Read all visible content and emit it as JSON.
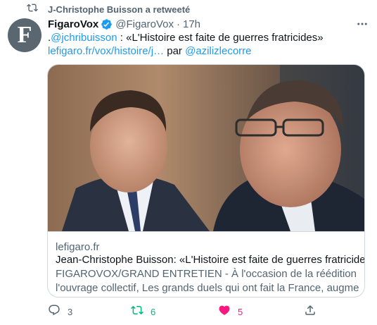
{
  "retweet_banner": {
    "text": "J-Christophe Buisson a retweeté"
  },
  "author": {
    "display_name": "FigaroVox",
    "handle": "@FigaroVox",
    "separator": "·",
    "time": "17h",
    "avatar_letter": "F"
  },
  "tweet": {
    "line1": {
      "prefix": ".",
      "mention": "@jchribuisson",
      "text": " : «L'Histoire est faite de guerres fratricides»"
    },
    "line2": {
      "link": "lefigaro.fr/vox/histoire/j…",
      "par": "par",
      "mention": "@azilizlecorre"
    }
  },
  "card": {
    "domain": "lefigaro.fr",
    "title": "Jean-Christophe Buisson: «L'Histoire est faite de guerres fratricides»",
    "description_line1": "FIGAROVOX/GRAND ENTRETIEN - À l'occasion de la réédition de",
    "description_line2": "l'ouvrage collectif, Les grands duels qui ont fait la France, augmentée …"
  },
  "actions": {
    "reply_count": "3",
    "retweet_count": "6",
    "like_count": "5"
  },
  "colors": {
    "accent": "#1d9bf0",
    "retweet_active": "#00ba7c",
    "like_active": "#f91880",
    "secondary_text": "#536471"
  },
  "icons": [
    "retweet-icon",
    "verified-badge-icon",
    "more-icon",
    "reply-icon",
    "retweet-icon",
    "heart-filled-icon",
    "share-icon"
  ]
}
